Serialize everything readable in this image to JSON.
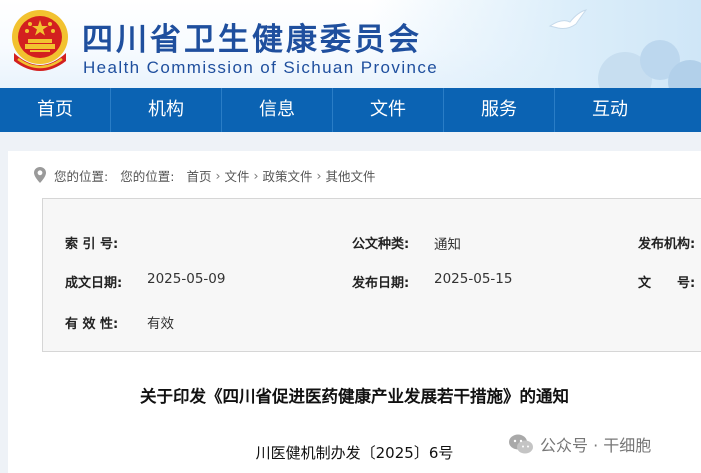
{
  "header": {
    "title": "四川省卫生健康委员会",
    "subtitle": "Health Commission of Sichuan Province"
  },
  "nav": {
    "items": [
      "首页",
      "机构",
      "信息",
      "文件",
      "服务",
      "互动"
    ]
  },
  "breadcrumb": {
    "prefix_a": "您的位置:",
    "prefix_b": "您的位置:",
    "items": [
      "首页",
      "文件",
      "政策文件",
      "其他文件"
    ]
  },
  "meta": {
    "index_label": "索 引 号:",
    "index_value": "",
    "doc_type_label": "公文种类:",
    "doc_type_value": "通知",
    "publisher_label": "发布机构:",
    "created_label": "成文日期:",
    "created_value": "2025-05-09",
    "published_label": "发布日期:",
    "published_value": "2025-05-15",
    "doc_no_label": "文　　号:",
    "validity_label": "有 效 性:",
    "validity_value": "有效"
  },
  "document": {
    "title": "关于印发《四川省促进医药健康产业发展若干措施》的通知",
    "number": "川医健机制办发〔2025〕6号"
  },
  "watermark": {
    "text": "公众号 · 干细胞"
  },
  "colors": {
    "brand_blue": "#1f4f9e",
    "nav_blue": "#0b63b3",
    "emblem_red": "#d3201f",
    "emblem_gold": "#f2c230"
  }
}
